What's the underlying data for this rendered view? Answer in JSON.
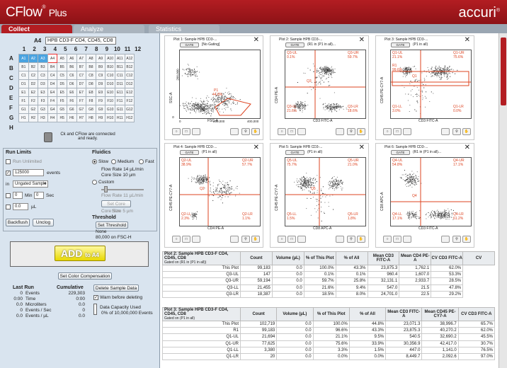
{
  "app": {
    "brand": "CFlow",
    "brand_suffix": "Plus",
    "registered": "®",
    "company": "accuri",
    "company_mark": "®"
  },
  "tabs": [
    {
      "label": "Collect"
    },
    {
      "label": "Analyze"
    },
    {
      "label": "Statistics"
    }
  ],
  "plate": {
    "well": "A4",
    "name": "HPB CD3-F CD4, CD45, CD8",
    "columns": [
      "1",
      "2",
      "3",
      "4",
      "5",
      "6",
      "7",
      "8",
      "9",
      "10",
      "11",
      "12"
    ],
    "rows": [
      "A",
      "B",
      "C",
      "D",
      "E",
      "F",
      "G",
      "H"
    ]
  },
  "connection": {
    "status": "Ck and CFlow are connected and ready."
  },
  "run_limits": {
    "title": "Run Limits",
    "run_unlimited": "Run Unlimited",
    "events_value": "125000",
    "events_label": "events",
    "in_label": "in",
    "sample_option": "Ungated Sample",
    "min_value": "0",
    "min_label": "Min",
    "sec_value": "0",
    "sec_label": "Sec",
    "ul_value": "0.0",
    "ul_label": "µL",
    "backflush": "Backflush",
    "unclog": "Unclog"
  },
  "fluidics": {
    "title": "Fluidics",
    "slow": "Slow",
    "medium": "Medium",
    "fast": "Fast",
    "flow_rate": "Flow Rate 14 µL/min",
    "core_size": "Core Size 10 µm",
    "custom": "Custom",
    "custom_flow": "Flow Rate 11 µL/min",
    "set_core": "Set Core Size",
    "custom_core": "Core Size 5 µm"
  },
  "threshold": {
    "title": "Threshold",
    "button": "Set Threshold",
    "line1": "None",
    "line2": "80,000 on FSC-H"
  },
  "add_button": {
    "label": "ADD",
    "suffix": "to A4"
  },
  "color_comp": "Set Color Compensation",
  "last_run": {
    "title": "Last Run",
    "cumulative": "Cumulative",
    "delete": "Delete Sample Data",
    "warn": "Warn before deleting",
    "rows": [
      {
        "a": "0",
        "label": "Events",
        "b": "229,303"
      },
      {
        "a": "0:00",
        "label": "Time",
        "b": "0:00"
      },
      {
        "a": "0.0",
        "label": "Microliters",
        "b": "0.0"
      },
      {
        "a": "0",
        "label": "Events / Sec",
        "b": "0"
      },
      {
        "a": "0.0",
        "label": "Events / µL",
        "b": "0.0"
      }
    ],
    "capacity_title": "Data Capacity Used",
    "capacity": "0% of 10,000,000 Events",
    "capacity_fraction": 0.0
  },
  "plots": [
    {
      "title": "Plot 1: Sample HPB CD3-...",
      "gate": "GATE",
      "gate_val": "[No Gating]",
      "y": "SSC-A",
      "x": "FSC-A",
      "yt": [
        "200,000",
        "0"
      ],
      "xt": [
        "0",
        "200,000",
        "400,000"
      ],
      "labels": [
        "P1",
        "44.8%"
      ]
    },
    {
      "title": "Plot 2: Sample HPB CD3-...",
      "gate": "GATE",
      "gate_val": "(R1 in (P1 in all)...",
      "y": "CD4 PE-A",
      "x": "CD3 FITC-A",
      "labels": [
        "Q3-UL",
        "0.1%",
        "Q3-UR",
        "59.7%",
        "Q3",
        "Q3-LL",
        "21.6%",
        "Q3-LR",
        "18.6%"
      ]
    },
    {
      "title": "Plot 3: Sample HPB CD3-...",
      "gate": "GATE",
      "gate_val": "(P1 in all)",
      "y": "CD45 PE-CY7-A",
      "x": "CD3 FITC-A",
      "labels": [
        "Q1-UL",
        "21.1%",
        "Q1-UR",
        "75.6%",
        "R1",
        "99.6%",
        "Q1",
        "Q1-LL",
        "3.0%",
        "Q1-LR",
        "0.0%"
      ]
    },
    {
      "title": "Plot 4: Sample HPB CD3-...",
      "gate": "GATE",
      "gate_val": "(P1 in all)",
      "y": "CD45 PE-CY7-A",
      "x": "CD4 PE-A",
      "labels": [
        "Q2-UL",
        "38.9%",
        "Q2-UR",
        "57.7%",
        "Q2",
        "Q2-LL",
        "2.3%",
        "Q2-LR",
        "1.1%"
      ]
    },
    {
      "title": "Plot 5: Sample HPB CD3-...",
      "gate": "GATE",
      "gate_val": "(P1 in all)",
      "y": "CD45 PE-CY7-A",
      "x": "CD8 APC-A",
      "labels": [
        "Q5-UL",
        "75.7%",
        "Q5-UR",
        "21.0%",
        "Q5",
        "Q5-LL",
        "1.5%",
        "Q5-LR",
        "1.8%"
      ]
    },
    {
      "title": "Plot 6: Sample HPB CD3-...",
      "gate": "GATE",
      "gate_val": "(R1 in (P1 in all)...",
      "y": "CD8 APC-A",
      "x": "CD3 FITC-A",
      "labels": [
        "Q4-UL",
        "54.8%",
        "Q4-UR",
        "17.1%",
        "Q4",
        "Q4-LL",
        "17.1%",
        "Q4-LR",
        "61.2%"
      ]
    }
  ],
  "table1": {
    "title": "Plot 2: Sample HPB CD3-F CD4, CD45, CD8",
    "sub": "Gated on (R1 in (P1 in all))",
    "headers": [
      "Count",
      "Volume (µL)",
      "% of This Plot",
      "% of All",
      "Mean CD3 FITC-A",
      "Mean CD4 PE-A",
      "CV CD3 FITC-A",
      "CV"
    ],
    "rows": [
      [
        "This Plot",
        "99,183",
        "0.0",
        "100.0%",
        "43.3%",
        "23,875.3",
        "1,762.1",
        "62.0%"
      ],
      [
        "Q3-UL",
        "147",
        "0.0",
        "0.1%",
        "0.1%",
        "960.4",
        "1,607.0",
        "53.3%"
      ],
      [
        "Q3-UR",
        "59,194",
        "0.0",
        "59.7%",
        "25.8%",
        "32,131.1",
        "2,933.7",
        "28.5%"
      ],
      [
        "Q3-LL",
        "21,455",
        "0.0",
        "21.6%",
        "9.4%",
        "547.0",
        "21.5",
        "47.8%"
      ],
      [
        "Q3-LR",
        "18,387",
        "0.0",
        "18.5%",
        "8.0%",
        "24,701.0",
        "22.5",
        "29.2%"
      ]
    ]
  },
  "table2": {
    "title": "Plot 3: Sample HPB CD3-F CD4, CD45, CD8",
    "sub": "Gated on (P1 in all)",
    "headers": [
      "Count",
      "Volume (µL)",
      "% of This Plot",
      "% of All",
      "Mean CD3 FITC-A",
      "Mean CD45 PE-CY7-A",
      "CV CD3 FITC-A"
    ],
    "rows": [
      [
        "This Plot",
        "102,719",
        "0.0",
        "100.0%",
        "44.8%",
        "23,071.3",
        "38,996.7",
        "65.7%"
      ],
      [
        "R1",
        "99,183",
        "0.0",
        "96.6%",
        "43.3%",
        "23,875.3",
        "40,270.2",
        "62.0%"
      ],
      [
        "Q1-UL",
        "21,694",
        "0.0",
        "21.1%",
        "9.5%",
        "540.5",
        "32,690.2",
        "45.5%"
      ],
      [
        "Q1-UR",
        "77,625",
        "0.0",
        "75.6%",
        "33.9%",
        "30,356.9",
        "42,417.0",
        "30.7%"
      ],
      [
        "Q1-LL",
        "3,380",
        "0.0",
        "3.3%",
        "1.5%",
        "447.0",
        "1,141.0",
        "76.5%"
      ],
      [
        "Q1-LR",
        "20",
        "0.0",
        "0.0%",
        "0.0%",
        "8,449.7",
        "2,092.6",
        "97.0%"
      ]
    ]
  },
  "colors": {
    "brand": "#b31d22",
    "selected_well": "#4aa3e0",
    "gate_line": "#d42",
    "add": "#f5e400"
  }
}
